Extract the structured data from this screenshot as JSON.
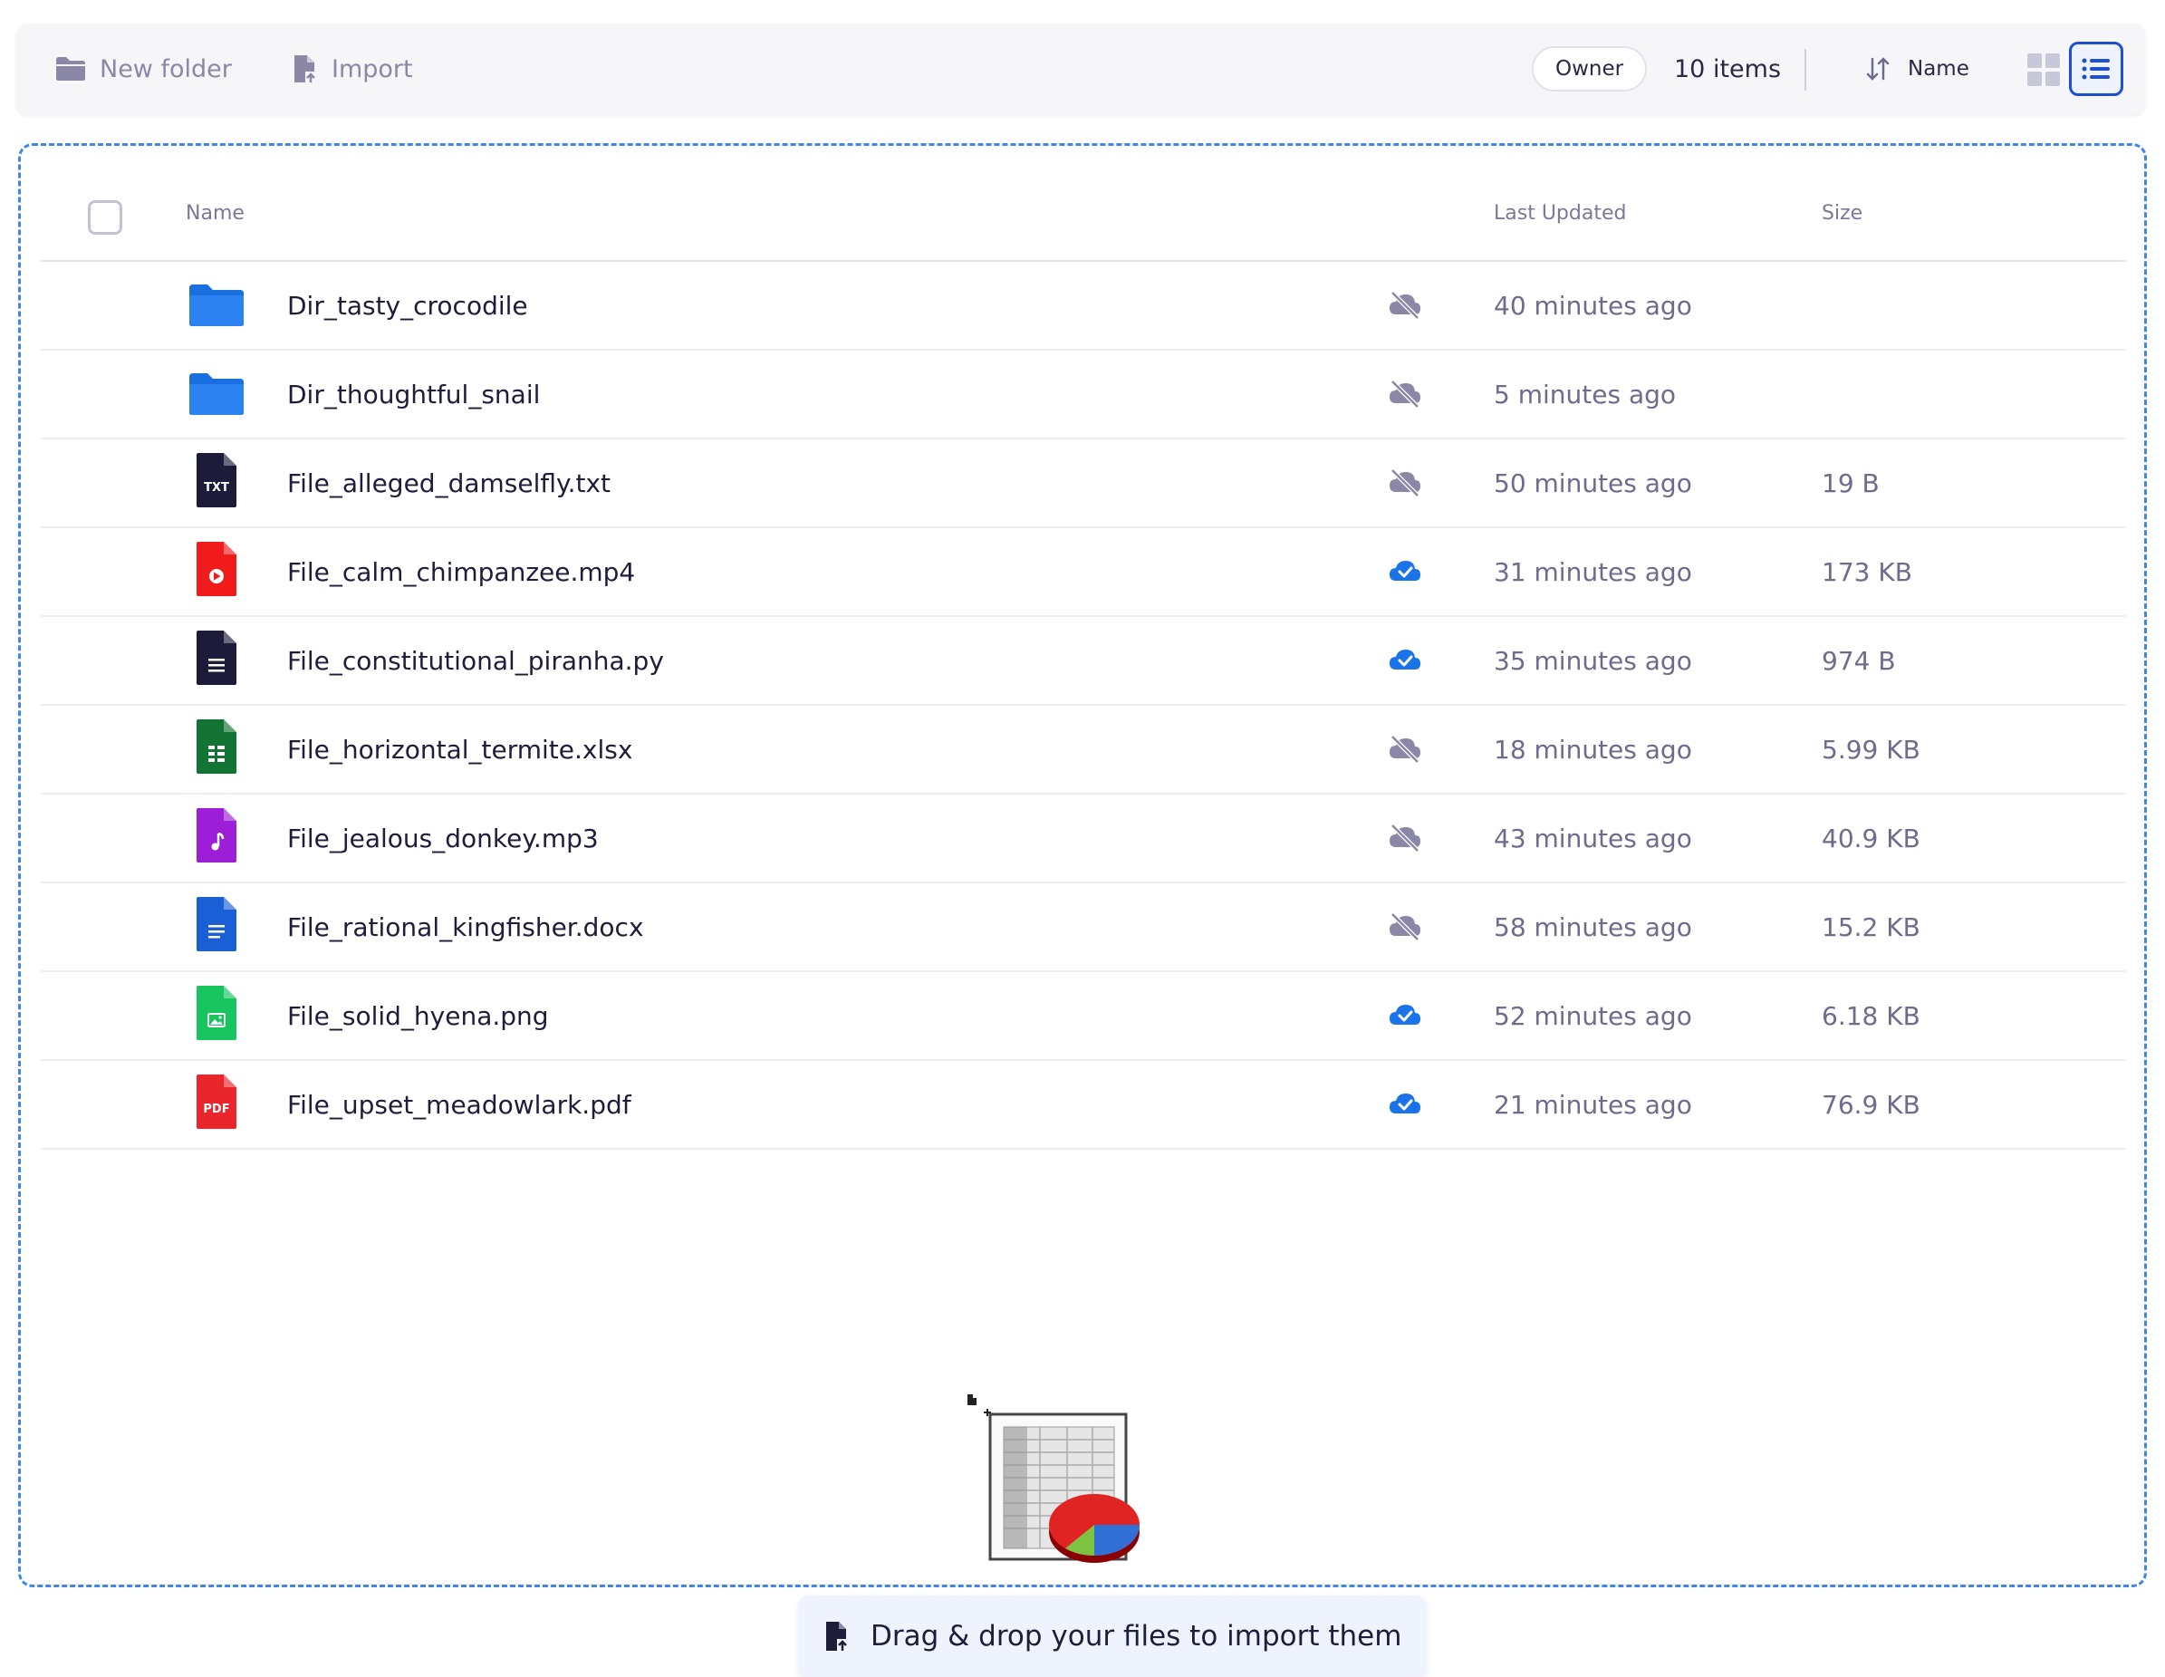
{
  "toolbar": {
    "new_folder_label": "New folder",
    "import_label": "Import",
    "owner_chip": "Owner",
    "items_count": "10 items",
    "sort_label": "Name",
    "view_mode": "list"
  },
  "table": {
    "headers": {
      "name": "Name",
      "last_updated": "Last Updated",
      "size": "Size"
    },
    "rows": [
      {
        "name": "Dir_tasty_crocodile",
        "icon": "folder-icon",
        "synced": false,
        "updated": "40 minutes ago",
        "size": ""
      },
      {
        "name": "Dir_thoughtful_snail",
        "icon": "folder-icon",
        "synced": false,
        "updated": "5 minutes ago",
        "size": ""
      },
      {
        "name": "File_alleged_damselfly.txt",
        "icon": "txt-file-icon",
        "synced": false,
        "updated": "50 minutes ago",
        "size": "19 B"
      },
      {
        "name": "File_calm_chimpanzee.mp4",
        "icon": "video-file-icon",
        "synced": true,
        "updated": "31 minutes ago",
        "size": "173 KB"
      },
      {
        "name": "File_constitutional_piranha.py",
        "icon": "code-file-icon",
        "synced": true,
        "updated": "35 minutes ago",
        "size": "974 B"
      },
      {
        "name": "File_horizontal_termite.xlsx",
        "icon": "spreadsheet-file-icon",
        "synced": false,
        "updated": "18 minutes ago",
        "size": "5.99 KB"
      },
      {
        "name": "File_jealous_donkey.mp3",
        "icon": "audio-file-icon",
        "synced": false,
        "updated": "43 minutes ago",
        "size": "40.9 KB"
      },
      {
        "name": "File_rational_kingfisher.docx",
        "icon": "document-file-icon",
        "synced": false,
        "updated": "58 minutes ago",
        "size": "15.2 KB"
      },
      {
        "name": "File_solid_hyena.png",
        "icon": "image-file-icon",
        "synced": true,
        "updated": "52 minutes ago",
        "size": "6.18 KB"
      },
      {
        "name": "File_upset_meadowlark.pdf",
        "icon": "pdf-file-icon",
        "synced": true,
        "updated": "21 minutes ago",
        "size": "76.9 KB"
      }
    ]
  },
  "dropzone": {
    "banner_text": "Drag & drop your files to import them"
  },
  "colors": {
    "accent": "#1e4fd1",
    "folder": "#1a6fe0",
    "synced": "#1a73e8",
    "not_synced": "#8a88a6",
    "dropzone_border": "#3f86e6"
  }
}
